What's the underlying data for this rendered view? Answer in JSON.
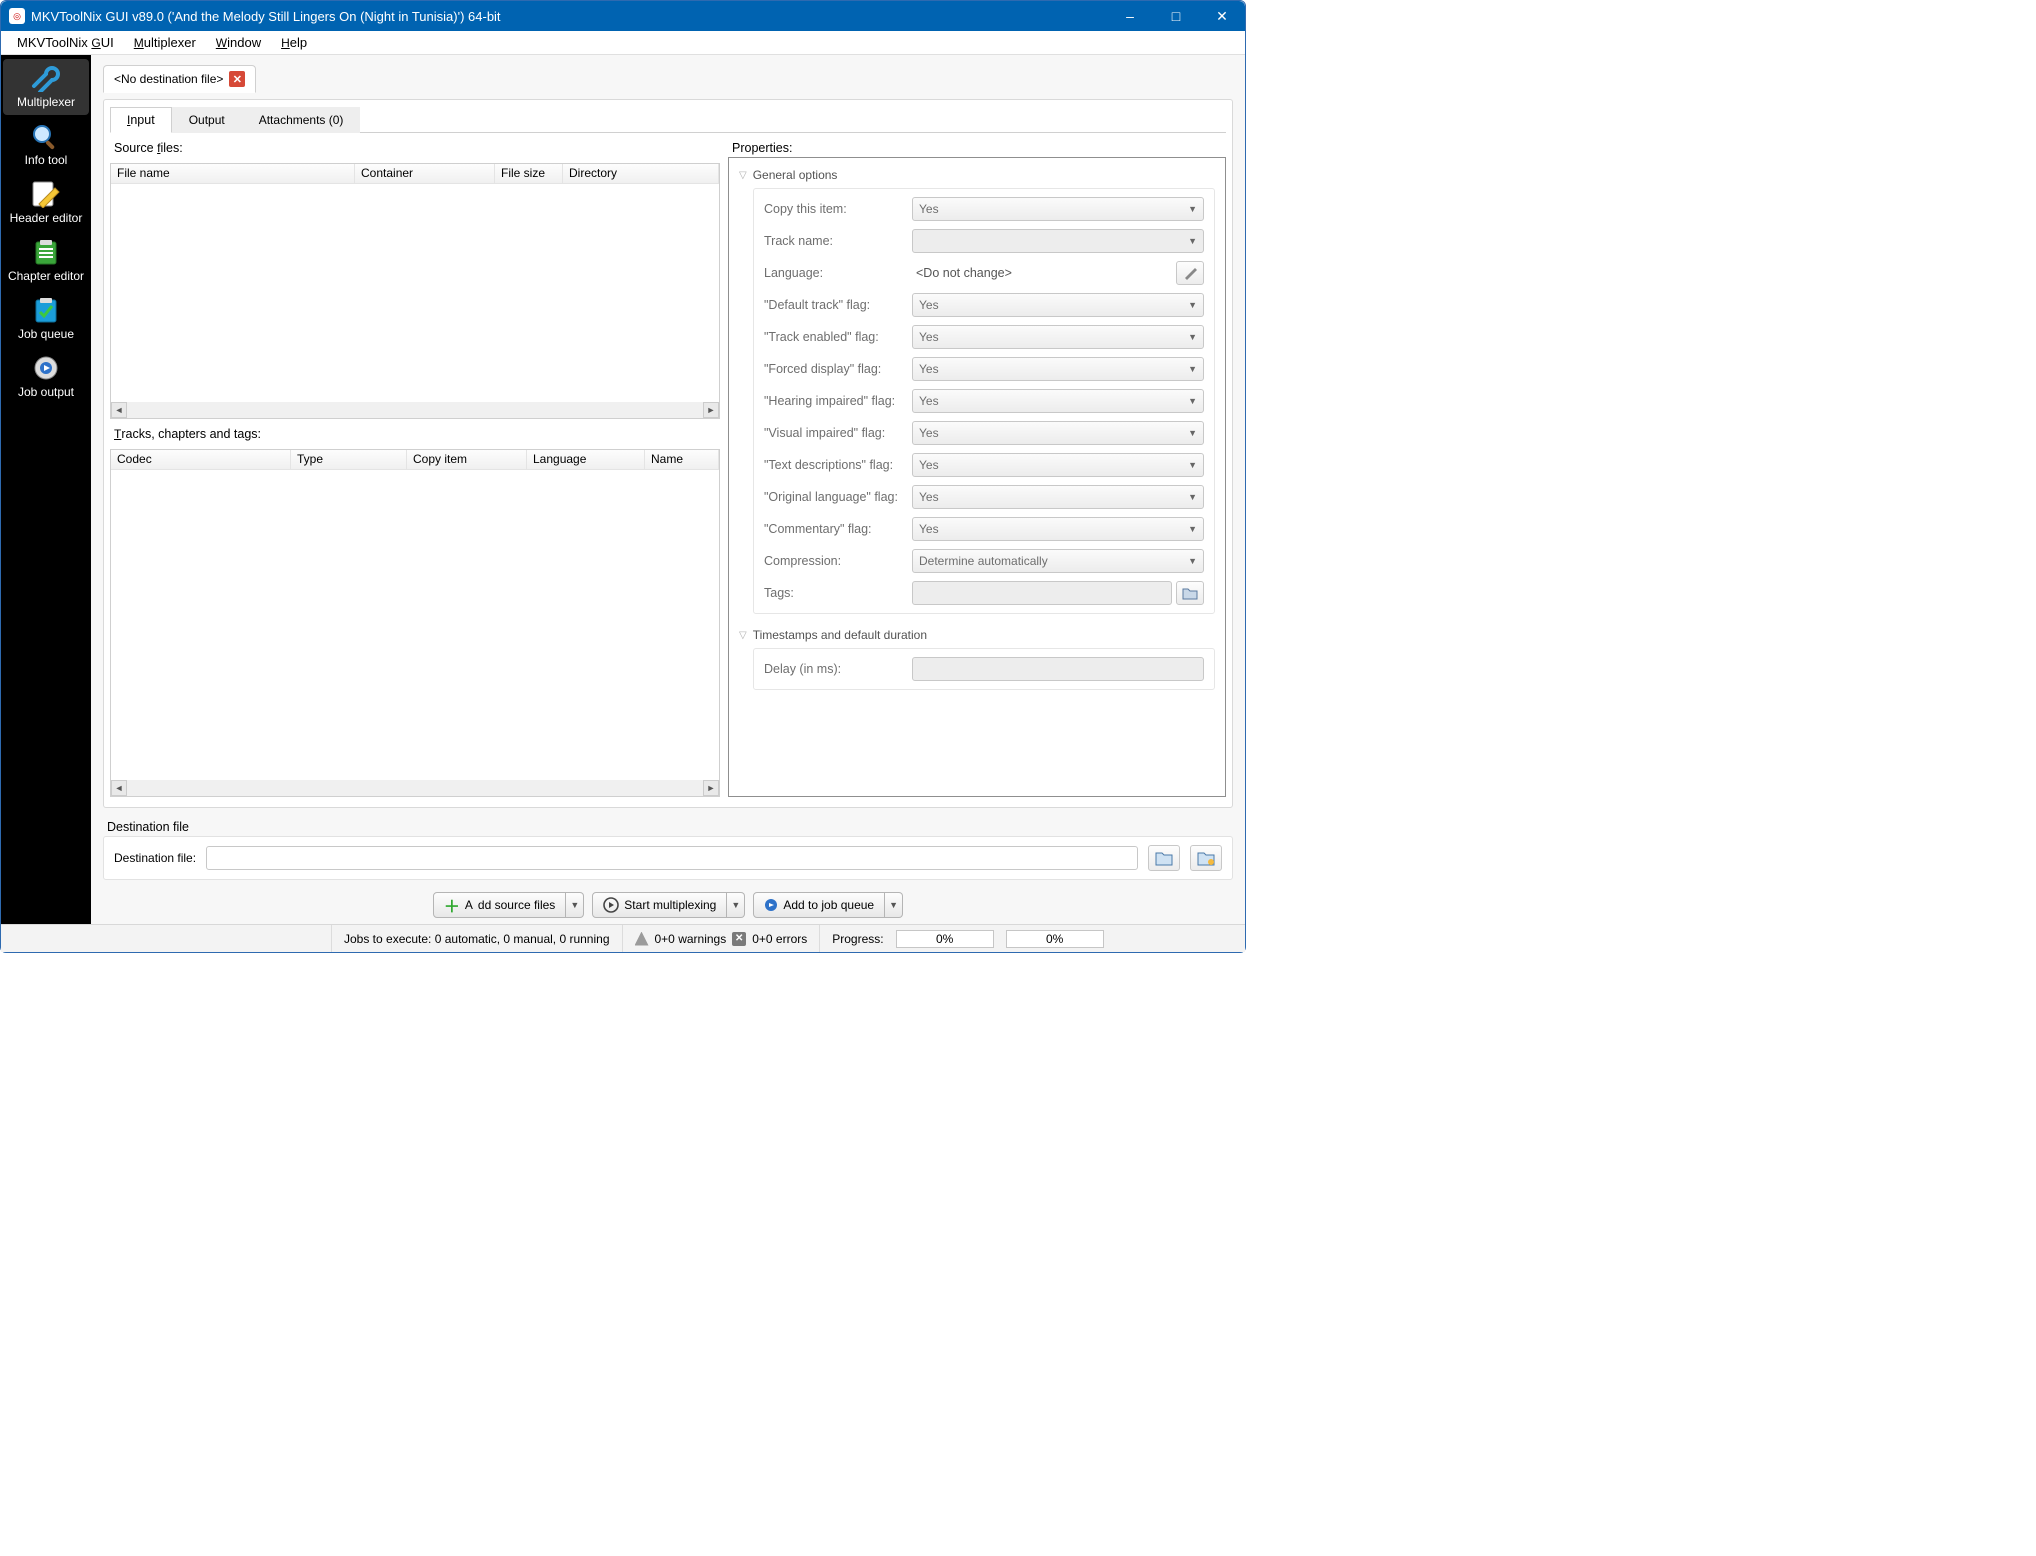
{
  "window": {
    "title": "MKVToolNix GUI v89.0 ('And the Melody Still Lingers On (Night in Tunisia)') 64-bit"
  },
  "menubar": {
    "items": [
      "MKVToolNix GUI",
      "Multiplexer",
      "Window",
      "Help"
    ],
    "underline_chars": [
      "G",
      "M",
      "W",
      "H"
    ]
  },
  "sidebar": {
    "items": [
      {
        "label": "Multiplexer"
      },
      {
        "label": "Info tool"
      },
      {
        "label": "Header editor"
      },
      {
        "label": "Chapter editor"
      },
      {
        "label": "Job queue"
      },
      {
        "label": "Job output"
      }
    ]
  },
  "doc_tab": {
    "label": "<No destination file>"
  },
  "sub_tabs": {
    "input": "Input",
    "output": "Output",
    "attachments": "Attachments (0)"
  },
  "source_files": {
    "label": "Source files:",
    "cols": [
      "File name",
      "Container",
      "File size",
      "Directory"
    ]
  },
  "tracks": {
    "label": "Tracks, chapters and tags:",
    "cols": [
      "Codec",
      "Type",
      "Copy item",
      "Language",
      "Name"
    ]
  },
  "properties": {
    "header": "Properties:",
    "group_general": "General options",
    "group_timestamps": "Timestamps and default duration",
    "rows": {
      "copy_item": {
        "label": "Copy this item:",
        "value": "Yes"
      },
      "track_name": {
        "label": "Track name:",
        "value": ""
      },
      "language": {
        "label": "Language:",
        "value": "<Do not change>"
      },
      "default_flag": {
        "label": "\"Default track\" flag:",
        "value": "Yes"
      },
      "enabled_flag": {
        "label": "\"Track enabled\" flag:",
        "value": "Yes"
      },
      "forced_flag": {
        "label": "\"Forced display\" flag:",
        "value": "Yes"
      },
      "hearing_flag": {
        "label": "\"Hearing impaired\" flag:",
        "value": "Yes"
      },
      "visual_flag": {
        "label": "\"Visual impaired\" flag:",
        "value": "Yes"
      },
      "textdesc_flag": {
        "label": "\"Text descriptions\" flag:",
        "value": "Yes"
      },
      "origlang_flag": {
        "label": "\"Original language\" flag:",
        "value": "Yes"
      },
      "commentary_flag": {
        "label": "\"Commentary\" flag:",
        "value": "Yes"
      },
      "compression": {
        "label": "Compression:",
        "value": "Determine automatically"
      },
      "tags": {
        "label": "Tags:",
        "value": ""
      },
      "delay": {
        "label": "Delay (in ms):",
        "value": ""
      }
    }
  },
  "destination": {
    "section_label": "Destination file",
    "field_label": "Destination file:",
    "value": ""
  },
  "actions": {
    "add_source": "Add source files",
    "start_mux": "Start multiplexing",
    "add_queue": "Add to job queue"
  },
  "status": {
    "jobs": "Jobs to execute:  0 automatic, 0 manual, 0 running",
    "warnings": "0+0 warnings",
    "errors": "0+0 errors",
    "progress_label": "Progress:",
    "progress_current": "0%",
    "progress_total": "0%"
  }
}
